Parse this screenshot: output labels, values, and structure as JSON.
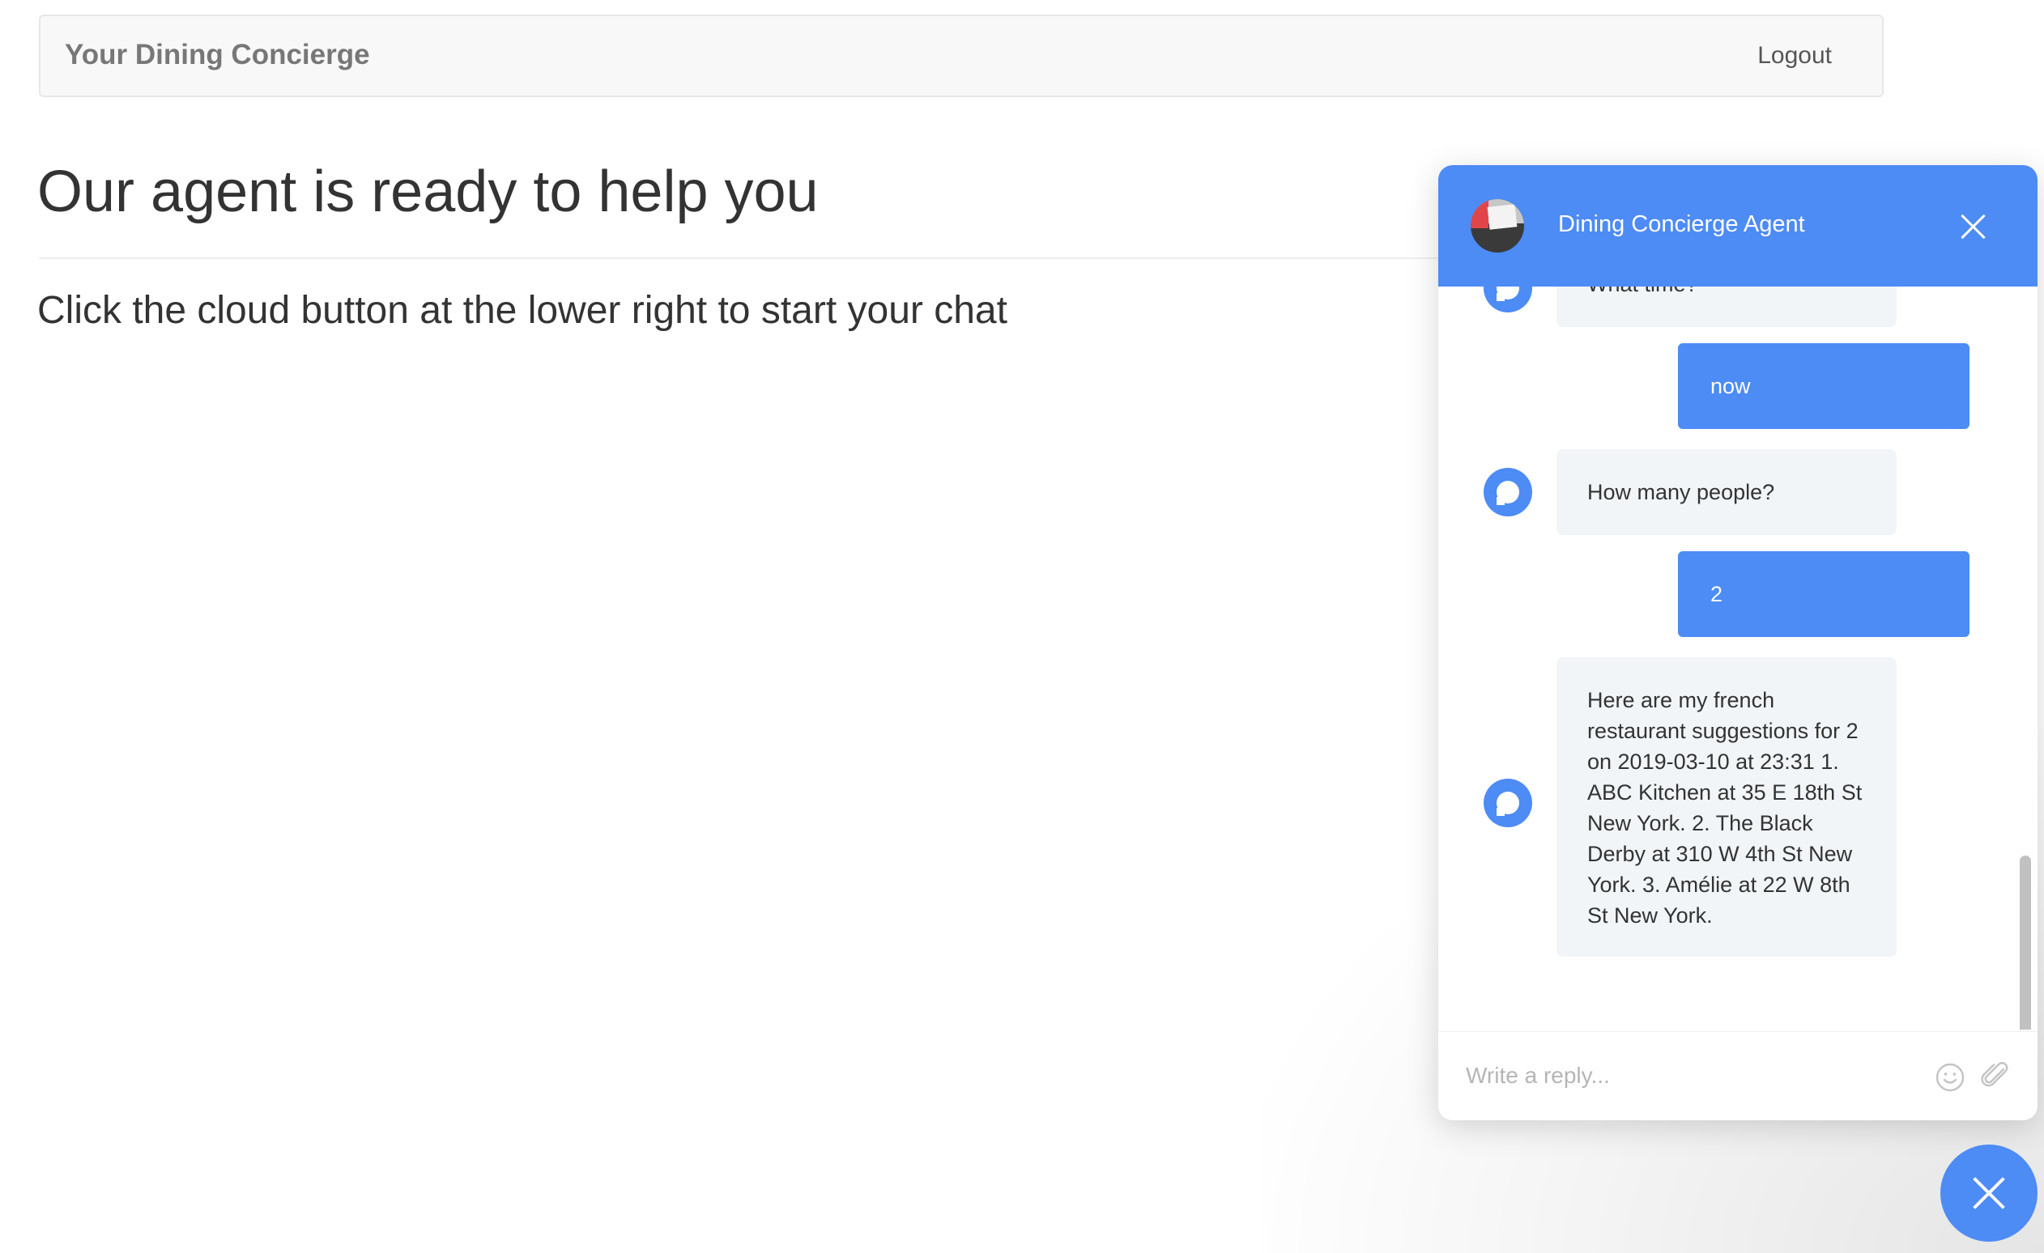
{
  "navbar": {
    "brand": "Your Dining Concierge",
    "logout_label": "Logout"
  },
  "main": {
    "heading": "Our agent is ready to help you",
    "instructions": "Click the cloud button at the lower right to start your chat"
  },
  "chat": {
    "title": "Dining Concierge Agent",
    "messages": [
      {
        "sender": "bot",
        "text": "What time?"
      },
      {
        "sender": "user",
        "text": "now"
      },
      {
        "sender": "bot",
        "text": "How many people?"
      },
      {
        "sender": "user",
        "text": "2"
      },
      {
        "sender": "bot",
        "text": "Here are my french restaurant suggestions for 2 on 2019-03-10 at 23:31 1. ABC Kitchen at 35 E 18th St New York. 2. The Black Derby at 310 W 4th St New York. 3. Amélie at 22 W 8th St New York."
      }
    ],
    "reply": {
      "placeholder": "Write a reply...",
      "value": ""
    }
  },
  "icons": {
    "header_close": "close-icon",
    "emoji": "smiley-icon",
    "attach": "paperclip-icon",
    "launcher": "close-icon"
  },
  "colors": {
    "accent": "#4d8bf5",
    "bot_bubble": "#f2f5f8",
    "navbar_bg": "#f8f8f8"
  }
}
